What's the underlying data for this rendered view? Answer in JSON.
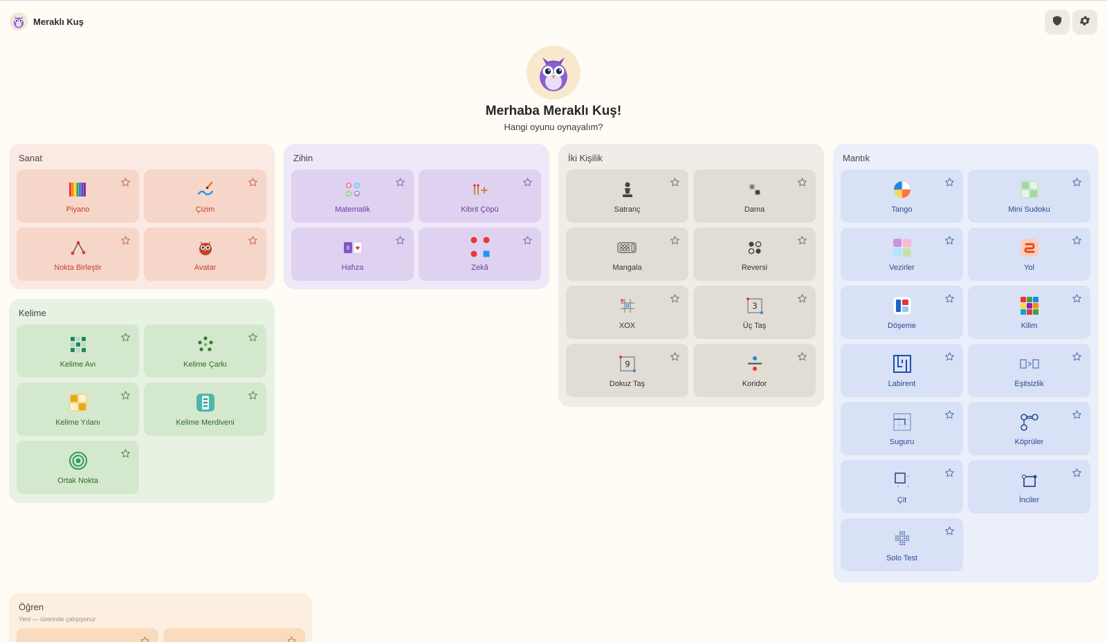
{
  "app": {
    "name": "Meraklı Kuş"
  },
  "hero": {
    "greeting": "Merhaba Meraklı Kuş!",
    "subtitle": "Hangi oyunu oynayalım?"
  },
  "header_icons": [
    "shield-icon",
    "gear-icon"
  ],
  "colors": {
    "background": "#fffbf5",
    "sanat": "#c0432a",
    "kelime": "#2f6b26",
    "zihin": "#6a3f9e",
    "iki_kisilik": "#333333",
    "mantik": "#2c4a91",
    "ogren": "#f8dcbd"
  },
  "sections": {
    "sanat": {
      "title": "Sanat",
      "games": [
        {
          "label": "Piyano",
          "icon": "piano-icon"
        },
        {
          "label": "Çizim",
          "icon": "brush-icon"
        },
        {
          "label": "Nokta Birleştir",
          "icon": "connect-dots-icon"
        },
        {
          "label": "Avatar",
          "icon": "owl-avatar-icon"
        }
      ]
    },
    "kelime": {
      "title": "Kelime",
      "games": [
        {
          "label": "Kelime Avı",
          "icon": "word-search-icon"
        },
        {
          "label": "Kelime Çarkı",
          "icon": "word-wheel-icon"
        },
        {
          "label": "Kelime Yılanı",
          "icon": "word-snake-icon"
        },
        {
          "label": "Kelime Merdiveni",
          "icon": "word-ladder-icon"
        },
        {
          "label": "Ortak Nokta",
          "icon": "target-icon"
        }
      ]
    },
    "zihin": {
      "title": "Zihin",
      "games": [
        {
          "label": "Matematik",
          "icon": "math-icon"
        },
        {
          "label": "Kibrit Çöpü",
          "icon": "matchstick-icon"
        },
        {
          "label": "Hafıza",
          "icon": "memory-cards-icon"
        },
        {
          "label": "Zekâ",
          "icon": "colored-dots-icon"
        }
      ]
    },
    "iki_kisilik": {
      "title": "İki Kişilik",
      "games": [
        {
          "label": "Satranç",
          "icon": "chess-pawn-icon"
        },
        {
          "label": "Dama",
          "icon": "checkers-icon"
        },
        {
          "label": "Mangala",
          "icon": "mangala-board-icon"
        },
        {
          "label": "Reversi",
          "icon": "reversi-icon"
        },
        {
          "label": "XOX",
          "icon": "tic-tac-toe-icon"
        },
        {
          "label": "Üç Taş",
          "icon": "three-stones-icon"
        },
        {
          "label": "Dokuz Taş",
          "icon": "nine-stones-icon"
        },
        {
          "label": "Koridor",
          "icon": "corridor-icon"
        }
      ]
    },
    "mantik": {
      "title": "Mantık",
      "games": [
        {
          "label": "Tango",
          "icon": "tango-icon"
        },
        {
          "label": "Mini Sudoku",
          "icon": "mini-sudoku-icon"
        },
        {
          "label": "Vezirler",
          "icon": "queens-icon"
        },
        {
          "label": "Yol",
          "icon": "path-icon"
        },
        {
          "label": "Döşeme",
          "icon": "tiling-icon"
        },
        {
          "label": "Kilim",
          "icon": "kilim-icon"
        },
        {
          "label": "Labirent",
          "icon": "maze-icon"
        },
        {
          "label": "Eşitsizlik",
          "icon": "inequality-icon"
        },
        {
          "label": "Suguru",
          "icon": "suguru-icon"
        },
        {
          "label": "Köprüler",
          "icon": "bridges-icon"
        },
        {
          "label": "Çit",
          "icon": "fence-icon"
        },
        {
          "label": "İnciler",
          "icon": "pearls-icon"
        },
        {
          "label": "Solo Test",
          "icon": "peg-solitaire-icon"
        }
      ]
    },
    "ogren": {
      "title": "Öğren",
      "subtitle": "Yeni — üzerinde çalışıyoruz",
      "games": [
        {
          "label": ""
        },
        {
          "label": ""
        }
      ]
    }
  }
}
